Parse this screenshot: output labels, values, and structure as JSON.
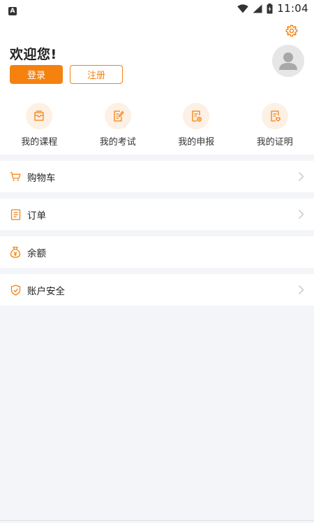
{
  "status_bar": {
    "time": "11:04",
    "notification_glyph": "A"
  },
  "header": {
    "greeting": "欢迎您!",
    "login_label": "登录",
    "register_label": "注册"
  },
  "quick_links": [
    {
      "label": "我的课程",
      "icon": "course-icon"
    },
    {
      "label": "我的考试",
      "icon": "exam-icon"
    },
    {
      "label": "我的申报",
      "icon": "application-icon"
    },
    {
      "label": "我的证明",
      "icon": "certificate-icon"
    }
  ],
  "menu": [
    {
      "label": "购物车",
      "icon": "cart-icon",
      "has_chevron": true
    },
    {
      "label": "订单",
      "icon": "order-icon",
      "has_chevron": true
    },
    {
      "label": "余额",
      "icon": "balance-icon",
      "has_chevron": false
    },
    {
      "label": "账户安全",
      "icon": "shield-icon",
      "has_chevron": true
    }
  ],
  "colors": {
    "accent": "#f5810f",
    "accent_light": "#fdf0e4",
    "background": "#f3f5f8"
  }
}
